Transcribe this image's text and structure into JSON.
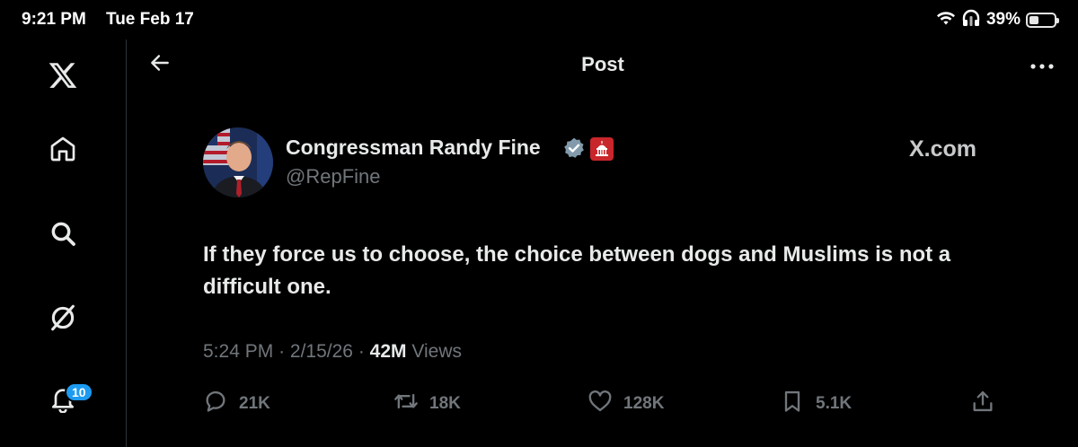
{
  "status_bar": {
    "time": "9:21 PM",
    "date": "Tue Feb 17",
    "battery_percent": "39%",
    "battery_level": 0.39,
    "icons": [
      "wifi-icon",
      "headphones-icon",
      "battery-icon"
    ]
  },
  "sidebar": {
    "items": [
      {
        "name": "x-logo",
        "icon": "x-logo-icon"
      },
      {
        "name": "home",
        "icon": "home-icon"
      },
      {
        "name": "explore",
        "icon": "search-icon"
      },
      {
        "name": "grok",
        "icon": "grok-icon"
      },
      {
        "name": "notifications",
        "icon": "bell-icon"
      }
    ],
    "notifications_badge": "10"
  },
  "header": {
    "title": "Post",
    "back_icon": "arrow-left-icon",
    "more_icon": "more-icon"
  },
  "post": {
    "author_name": "Congressman Randy Fine",
    "author_handle": "@RepFine",
    "verified_icon": "verified-badge-icon",
    "affiliation_icon": "capitol-badge-icon",
    "watermark": "X.com",
    "text": "If they force us to choose, the choice between dogs and Muslims is not a difficult one.",
    "time": "5:24 PM",
    "date": "2/15/26",
    "separator": "·",
    "views_count": "42M",
    "views_label": "Views",
    "replies": "21K",
    "reposts": "18K",
    "likes": "128K",
    "bookmarks": "5.1K"
  },
  "colors": {
    "background": "#000000",
    "text": "#e7e9ea",
    "muted": "#71767b",
    "accent": "#1d9bf0",
    "divider": "#2f3336"
  }
}
